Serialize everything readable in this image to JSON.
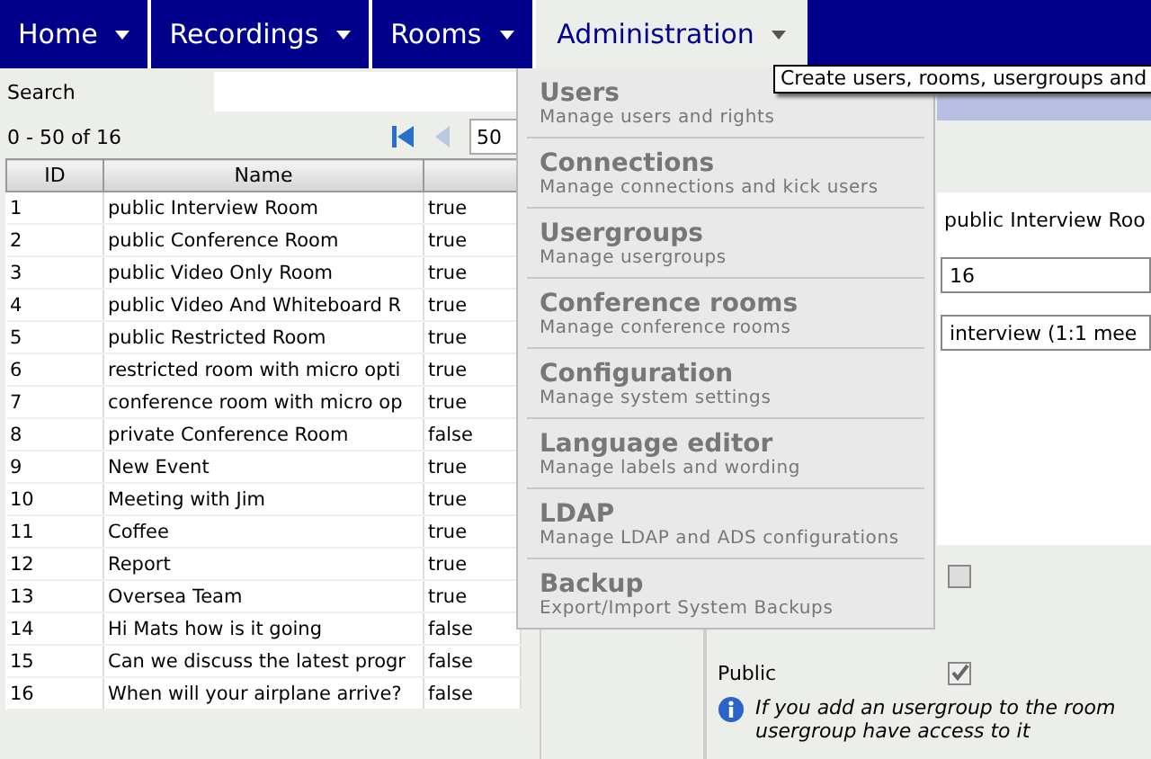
{
  "nav": [
    {
      "label": "Home",
      "selected": false
    },
    {
      "label": "Recordings",
      "selected": false
    },
    {
      "label": "Rooms",
      "selected": false
    },
    {
      "label": "Administration",
      "selected": true
    }
  ],
  "tooltip": "Create users, rooms, usergroups and",
  "search": {
    "label": "Search"
  },
  "pager": {
    "range": "0 - 50 of 16",
    "page_size": "50"
  },
  "table": {
    "columns": [
      "ID",
      "Name"
    ],
    "rows": [
      {
        "id": "1",
        "name": "public Interview Room",
        "column_3": "true"
      },
      {
        "id": "2",
        "name": "public Conference Room",
        "column_3": "true"
      },
      {
        "id": "3",
        "name": "public Video Only Room",
        "column_3": "true"
      },
      {
        "id": "4",
        "name": "public Video And Whiteboard R",
        "column_3": "true"
      },
      {
        "id": "5",
        "name": "public Restricted Room",
        "column_3": "true"
      },
      {
        "id": "6",
        "name": "restricted room with micro opti",
        "column_3": "true"
      },
      {
        "id": "7",
        "name": "conference room with micro op",
        "column_3": "true"
      },
      {
        "id": "8",
        "name": "private Conference Room",
        "column_3": "false"
      },
      {
        "id": "9",
        "name": "New Event",
        "column_3": "true"
      },
      {
        "id": "10",
        "name": "Meeting with Jim",
        "column_3": "true"
      },
      {
        "id": "11",
        "name": "Coffee",
        "column_3": "true"
      },
      {
        "id": "12",
        "name": "Report",
        "column_3": "true"
      },
      {
        "id": "13",
        "name": "Oversea Team",
        "column_3": "true"
      },
      {
        "id": "14",
        "name": "Hi Mats how is it going",
        "column_3": "false"
      },
      {
        "id": "15",
        "name": "Can we discuss the latest progr",
        "column_3": "false"
      },
      {
        "id": "16",
        "name": "When will your airplane arrive?",
        "column_3": "false"
      }
    ]
  },
  "form": {
    "name_value": "public Interview Roo",
    "count_value": "16",
    "type_value": "interview  (1:1 mee",
    "first_checkbox": {
      "checked": false
    },
    "public": {
      "label": "Public",
      "checked": true
    },
    "info": "If you add an usergroup to the room",
    "info_line_2": "usergroup have access to it"
  },
  "menu": [
    {
      "title": "Users",
      "description": "Manage users and rights"
    },
    {
      "title": "Connections",
      "description": "Manage connections and kick users"
    },
    {
      "title": "Usergroups",
      "description": "Manage usergroups"
    },
    {
      "title": "Conference rooms",
      "description": "Manage conference rooms"
    },
    {
      "title": "Configuration",
      "description": "Manage system settings"
    },
    {
      "title": "Language editor",
      "description": "Manage labels and wording"
    },
    {
      "title": "LDAP",
      "description": "Manage LDAP and ADS configurations"
    },
    {
      "title": "Backup",
      "description": "Export/Import System Backups"
    }
  ]
}
